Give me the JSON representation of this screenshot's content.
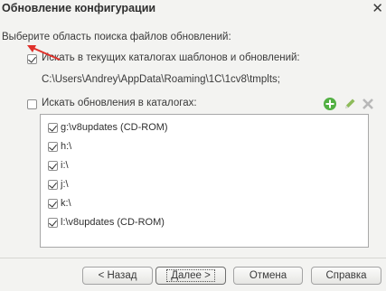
{
  "window": {
    "title": "Обновление конфигурации",
    "close_glyph": "✕"
  },
  "prompt": "Выберите область поиска файлов обновлений:",
  "option_templates": {
    "checked": true,
    "label": "Искать в текущих каталогах шаблонов и обновлений:",
    "path": "C:\\Users\\Andrey\\AppData\\Roaming\\1C\\1cv8\\tmplts;"
  },
  "option_catalogs": {
    "checked": false,
    "label": "Искать обновления в каталогах:"
  },
  "toolbar": {
    "add_icon": "add-icon",
    "edit_icon": "pencil-icon",
    "delete_icon": "delete-icon",
    "accent_add": "#4caf3a",
    "accent_edit": "#7bb04a",
    "accent_delete": "#b5b5b5"
  },
  "catalogs": [
    {
      "checked": true,
      "label": "g:\\v8updates (CD-ROM)"
    },
    {
      "checked": true,
      "label": "h:\\"
    },
    {
      "checked": true,
      "label": "i:\\"
    },
    {
      "checked": true,
      "label": "j:\\"
    },
    {
      "checked": true,
      "label": "k:\\"
    },
    {
      "checked": true,
      "label": "l:\\v8updates (CD-ROM)"
    }
  ],
  "buttons": {
    "back": "< Назад",
    "next": "Далее >",
    "cancel": "Отмена",
    "help": "Справка"
  },
  "annotation_arrow_color": "#e0312b"
}
